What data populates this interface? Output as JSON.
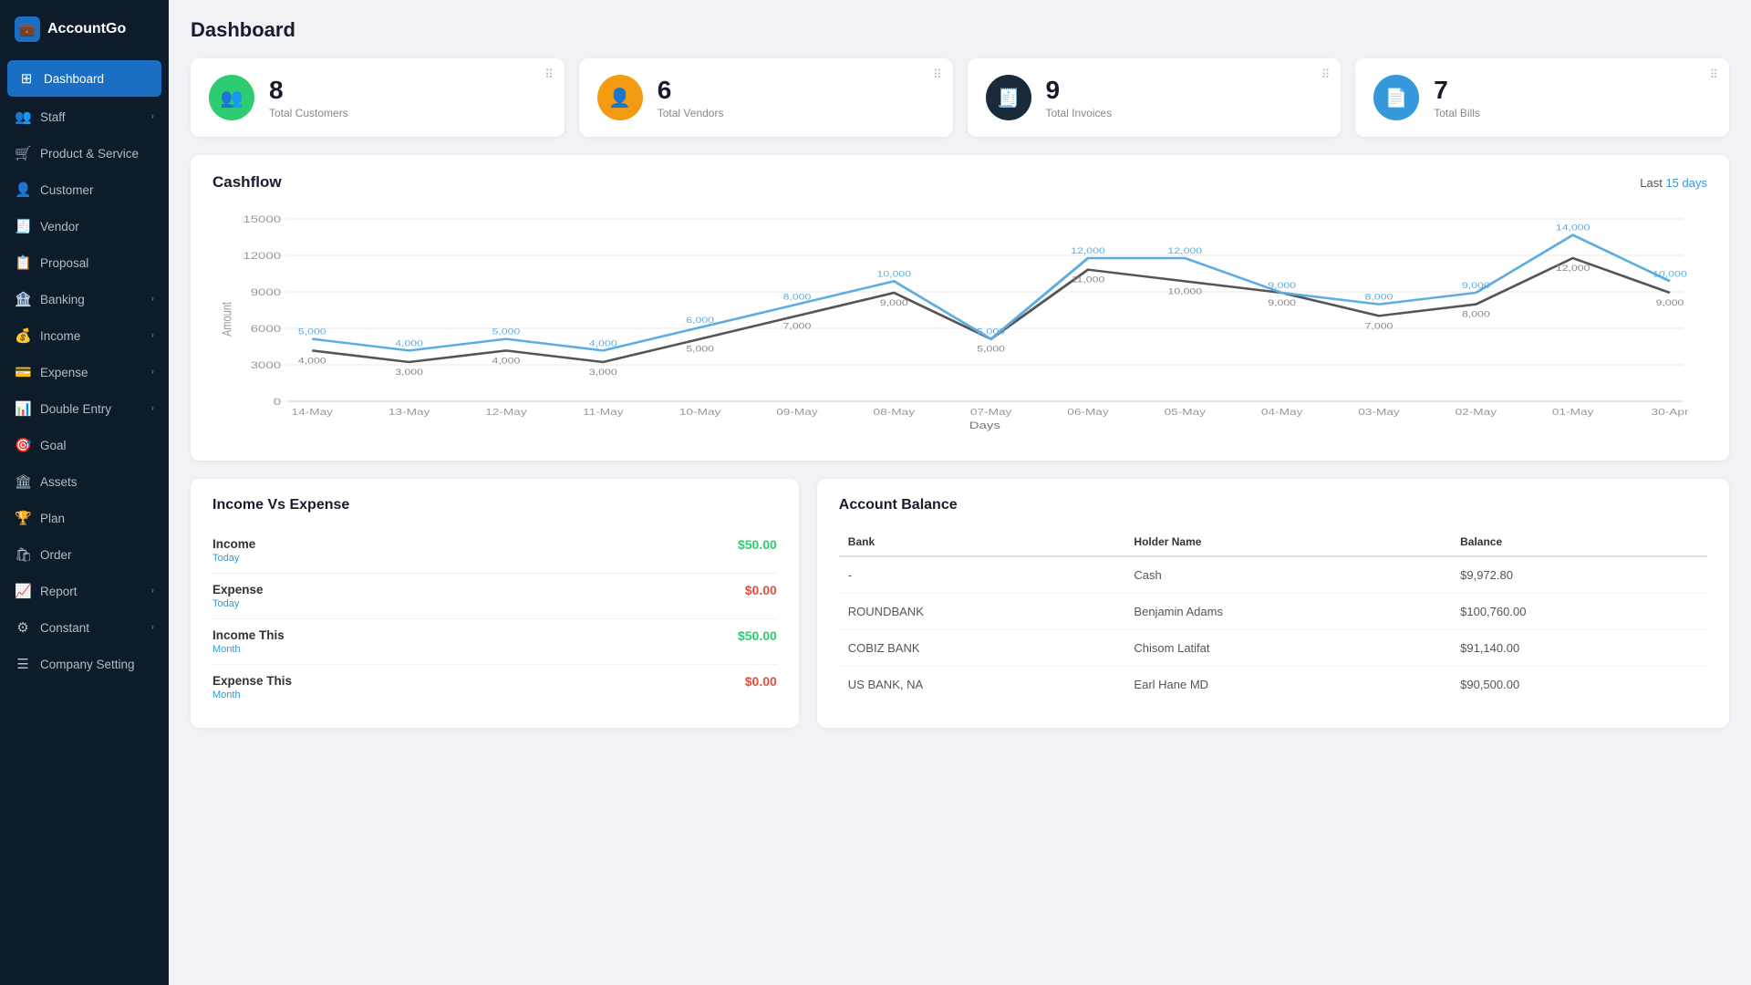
{
  "app": {
    "name": "AccountGo",
    "logo_icon": "💼"
  },
  "sidebar": {
    "items": [
      {
        "id": "dashboard",
        "label": "Dashboard",
        "icon": "⊞",
        "active": true,
        "hasChevron": false
      },
      {
        "id": "staff",
        "label": "Staff",
        "icon": "👥",
        "active": false,
        "hasChevron": true
      },
      {
        "id": "product-service",
        "label": "Product & Service",
        "icon": "🛒",
        "active": false,
        "hasChevron": false
      },
      {
        "id": "customer",
        "label": "Customer",
        "icon": "👤",
        "active": false,
        "hasChevron": false
      },
      {
        "id": "vendor",
        "label": "Vendor",
        "icon": "🧾",
        "active": false,
        "hasChevron": false
      },
      {
        "id": "proposal",
        "label": "Proposal",
        "icon": "📋",
        "active": false,
        "hasChevron": false
      },
      {
        "id": "banking",
        "label": "Banking",
        "icon": "🏦",
        "active": false,
        "hasChevron": true
      },
      {
        "id": "income",
        "label": "Income",
        "icon": "💰",
        "active": false,
        "hasChevron": true
      },
      {
        "id": "expense",
        "label": "Expense",
        "icon": "💳",
        "active": false,
        "hasChevron": true
      },
      {
        "id": "double-entry",
        "label": "Double Entry",
        "icon": "📊",
        "active": false,
        "hasChevron": true
      },
      {
        "id": "goal",
        "label": "Goal",
        "icon": "🎯",
        "active": false,
        "hasChevron": false
      },
      {
        "id": "assets",
        "label": "Assets",
        "icon": "🏛",
        "active": false,
        "hasChevron": false
      },
      {
        "id": "plan",
        "label": "Plan",
        "icon": "🏆",
        "active": false,
        "hasChevron": false
      },
      {
        "id": "order",
        "label": "Order",
        "icon": "🛍",
        "active": false,
        "hasChevron": false
      },
      {
        "id": "report",
        "label": "Report",
        "icon": "📈",
        "active": false,
        "hasChevron": true
      },
      {
        "id": "constant",
        "label": "Constant",
        "icon": "⚙",
        "active": false,
        "hasChevron": true
      },
      {
        "id": "company-setting",
        "label": "Company Setting",
        "icon": "☰",
        "active": false,
        "hasChevron": false
      }
    ]
  },
  "page": {
    "title": "Dashboard"
  },
  "stat_cards": [
    {
      "id": "customers",
      "number": "8",
      "label": "Total Customers",
      "icon": "👥",
      "color_class": "green"
    },
    {
      "id": "vendors",
      "number": "6",
      "label": "Total Vendors",
      "icon": "👤",
      "color_class": "orange"
    },
    {
      "id": "invoices",
      "number": "9",
      "label": "Total Invoices",
      "icon": "🧾",
      "color_class": "dark"
    },
    {
      "id": "bills",
      "number": "7",
      "label": "Total Bills",
      "icon": "📄",
      "color_class": "blue"
    }
  ],
  "cashflow": {
    "title": "Cashflow",
    "period_label": "Last",
    "period_value": "15 days",
    "x_axis_label": "Days",
    "y_axis_label": "Amount",
    "days": [
      "14-May",
      "13-May",
      "12-May",
      "11-May",
      "10-May",
      "09-May",
      "08-May",
      "07-May",
      "06-May",
      "05-May",
      "04-May",
      "03-May",
      "02-May",
      "01-May",
      "30-Apr"
    ],
    "income_data": [
      5000,
      4000,
      5000,
      4000,
      6000,
      8000,
      10000,
      5000,
      12000,
      12000,
      9000,
      8000,
      9000,
      14000,
      10000
    ],
    "expense_data": [
      4000,
      3000,
      4000,
      3000,
      5000,
      7000,
      9000,
      5000,
      11000,
      10000,
      9000,
      7000,
      8000,
      12000,
      9000
    ]
  },
  "income_vs_expense": {
    "title": "Income Vs Expense",
    "rows": [
      {
        "label": "Income",
        "sublabel": "Today",
        "value": "$50.00",
        "value_class": "green"
      },
      {
        "label": "Expense",
        "sublabel": "Today",
        "value": "$0.00",
        "value_class": "red"
      },
      {
        "label": "Income This",
        "sublabel": "Month",
        "value": "$50.00",
        "value_class": "green"
      },
      {
        "label": "Expense This",
        "sublabel": "Month",
        "value": "$0.00",
        "value_class": "red"
      }
    ]
  },
  "account_balance": {
    "title": "Account Balance",
    "columns": [
      "Bank",
      "Holder Name",
      "Balance"
    ],
    "rows": [
      {
        "bank": "-",
        "holder": "Cash",
        "balance": "$9,972.80"
      },
      {
        "bank": "ROUNDBANK",
        "holder": "Benjamin Adams",
        "balance": "$100,760.00"
      },
      {
        "bank": "COBIZ BANK",
        "holder": "Chisom Latifat",
        "balance": "$91,140.00"
      },
      {
        "bank": "US BANK, NA",
        "holder": "Earl Hane MD",
        "balance": "$90,500.00"
      }
    ]
  }
}
